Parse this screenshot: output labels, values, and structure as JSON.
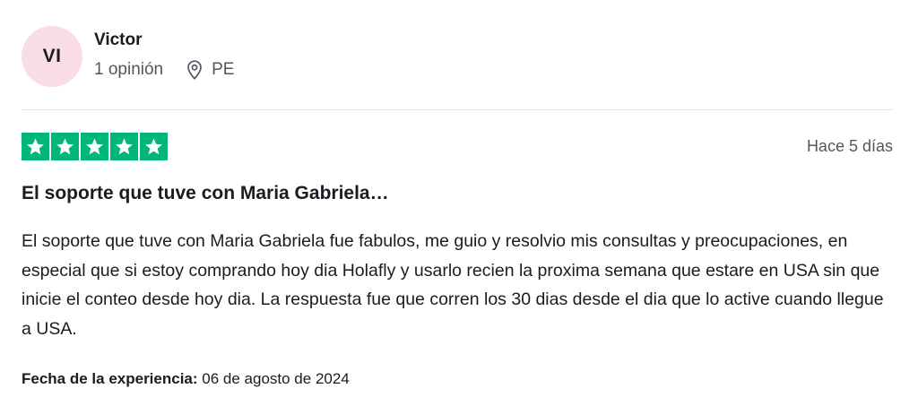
{
  "reviewer": {
    "initials": "VI",
    "name": "Victor",
    "review_count": "1 opinión",
    "country": "PE",
    "avatar_color": "#f9dde6"
  },
  "rating": {
    "stars": 5,
    "max_stars": 5,
    "star_color": "#00b67a"
  },
  "review": {
    "date": "Hace 5 días",
    "title": "El soporte que tuve con Maria Gabriela…",
    "body": "El soporte que tuve con Maria Gabriela fue fabulos, me guio y resolvio mis consultas y preocupaciones, en especial que si estoy comprando hoy dia Holafly y usarlo recien la proxima semana que estare en USA sin que inicie el conteo desde hoy dia. La respuesta fue que corren los 30 dias desde el dia que lo active cuando llegue a USA.",
    "experience_label": "Fecha de la experiencia:",
    "experience_date": "06 de agosto de 2024"
  },
  "icons": {
    "location": "location-pin-icon",
    "star": "star-icon"
  }
}
